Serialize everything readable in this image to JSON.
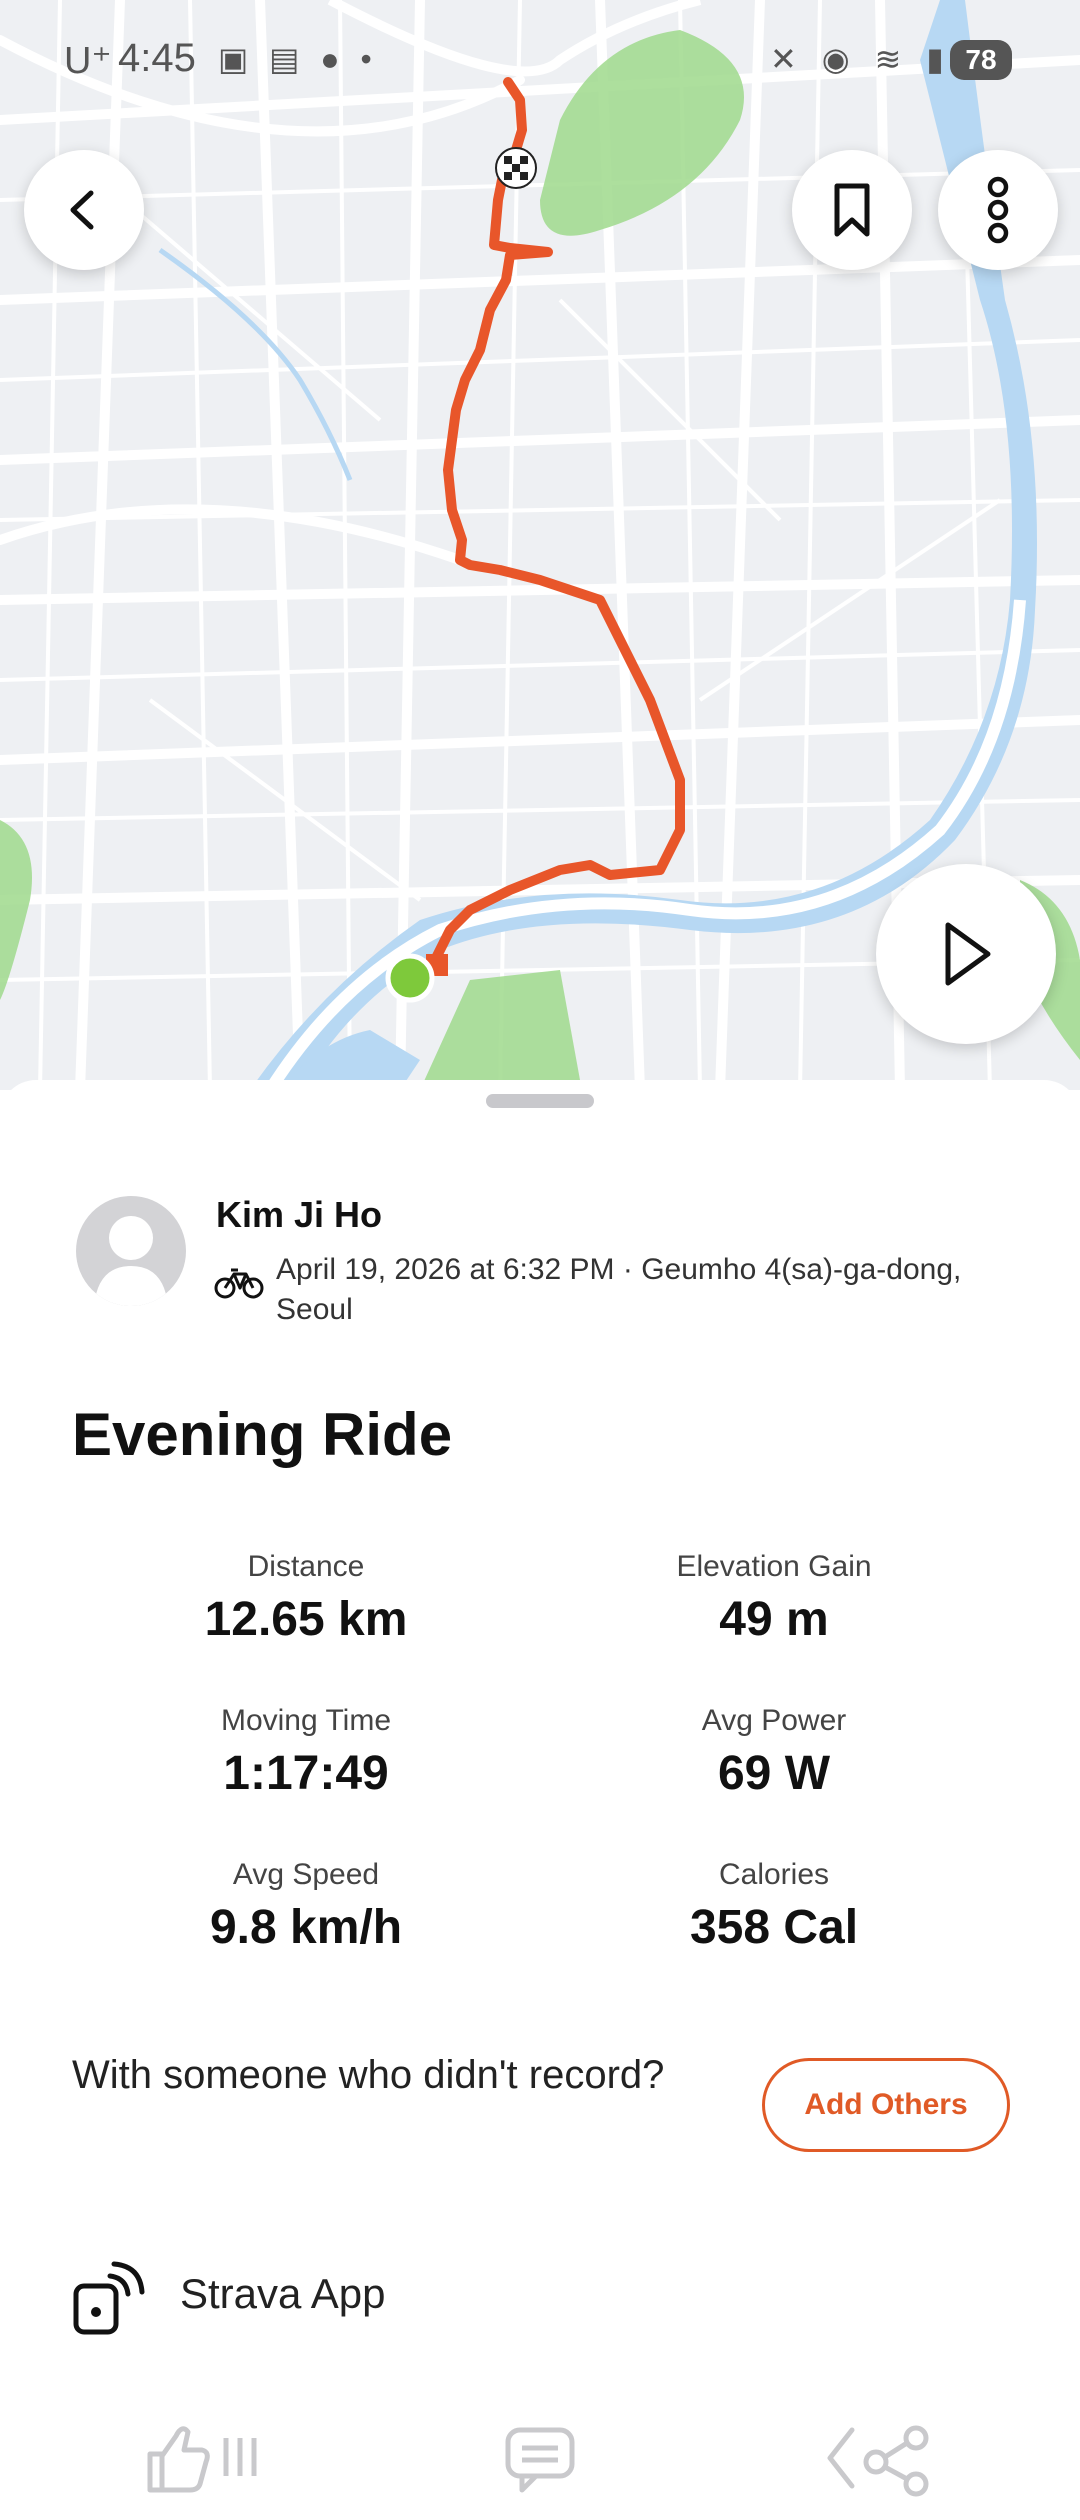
{
  "status_bar": {
    "carrier": "U⁺",
    "time": "4:45",
    "battery": "78"
  },
  "map": {
    "route_color": "#e8562a",
    "start_color": "#7ec93b",
    "park_color": "#9fd98c",
    "water_color": "#b7d8f3"
  },
  "header_buttons": {
    "back_icon": "chevron-left-icon",
    "bookmark_icon": "bookmark-icon",
    "more_icon": "more-vertical-icon",
    "play_icon": "play-icon"
  },
  "activity": {
    "athlete_name": "Kim Ji Ho",
    "meta": "April 19, 2026 at 6:32 PM · Geumho 4(sa)-ga-dong, Seoul",
    "title": "Evening Ride",
    "stats": [
      {
        "label": "Distance",
        "value": "12.65 km"
      },
      {
        "label": "Elevation Gain",
        "value": "49 m"
      },
      {
        "label": "Moving Time",
        "value": "1:17:49"
      },
      {
        "label": "Avg Power",
        "value": "69 W"
      },
      {
        "label": "Avg Speed",
        "value": "9.8 km/h"
      },
      {
        "label": "Calories",
        "value": "358 Cal"
      }
    ]
  },
  "with_others": {
    "text": "With someone who didn't record?",
    "button_label": "Add Others",
    "accent": "#e05a26"
  },
  "device": {
    "name": "Strava App"
  },
  "bottom_nav": {
    "like_icon": "thumbs-up-icon",
    "comment_icon": "comment-icon",
    "share_icon": "share-icon"
  }
}
